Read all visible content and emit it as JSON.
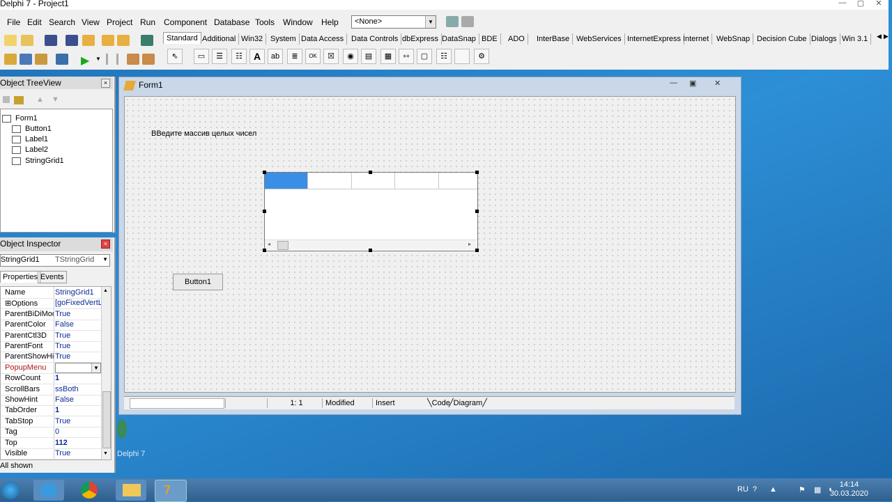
{
  "title_bar": {
    "title": "Delphi 7 - Project1"
  },
  "menu": [
    "File",
    "Edit",
    "Search",
    "View",
    "Project",
    "Run",
    "Component",
    "Database",
    "Tools",
    "Window",
    "Help"
  ],
  "config_combo": {
    "value": "<None>"
  },
  "palette_tabs": [
    "Standard",
    "Additional",
    "Win32",
    "System",
    "Data Access",
    "Data Controls",
    "dbExpress",
    "DataSnap",
    "BDE",
    "ADO",
    "InterBase",
    "WebServices",
    "InternetExpress",
    "Internet",
    "WebSnap",
    "Decision Cube",
    "Dialogs",
    "Win 3.1"
  ],
  "palette_active": "Standard",
  "tree_view": {
    "title": "Object TreeView",
    "root": "Form1",
    "children": [
      "Button1",
      "Label1",
      "Label2",
      "StringGrid1"
    ]
  },
  "inspector": {
    "title": "Object Inspector",
    "object_name": "StringGrid1",
    "object_type": "TStringGrid",
    "tabs": [
      "Properties",
      "Events"
    ],
    "properties": [
      {
        "name": "Name",
        "value": "StringGrid1",
        "bold": false
      },
      {
        "name": "⊞Options",
        "value": "[goFixedVertLi",
        "bold": false
      },
      {
        "name": "ParentBiDiMode",
        "value": "True",
        "bold": false
      },
      {
        "name": "ParentColor",
        "value": "False",
        "bold": false
      },
      {
        "name": "ParentCtl3D",
        "value": "True",
        "bold": false
      },
      {
        "name": "ParentFont",
        "value": "True",
        "bold": false
      },
      {
        "name": "ParentShowHint",
        "value": "True",
        "bold": false
      },
      {
        "name": "PopupMenu",
        "value": "",
        "bold": false,
        "selected": true
      },
      {
        "name": "RowCount",
        "value": "1",
        "bold": true
      },
      {
        "name": "ScrollBars",
        "value": "ssBoth",
        "bold": false
      },
      {
        "name": "ShowHint",
        "value": "False",
        "bold": false
      },
      {
        "name": "TabOrder",
        "value": "1",
        "bold": true
      },
      {
        "name": "TabStop",
        "value": "True",
        "bold": false
      },
      {
        "name": "Tag",
        "value": "0",
        "bold": false
      },
      {
        "name": "Top",
        "value": "112",
        "bold": true
      },
      {
        "name": "Visible",
        "value": "True",
        "bold": false
      }
    ],
    "status": "All shown"
  },
  "form": {
    "title": "Form1",
    "label_text": "ВВедите массив целых чисел",
    "button_caption": "Button1",
    "status": {
      "position": "1:   1",
      "modified": "Modified",
      "mode": "Insert",
      "tab_code": "Code",
      "tab_diagram": "Diagram"
    }
  },
  "taskbar": {
    "lang": "RU",
    "time": "14:14",
    "date": "30.03.2020",
    "desktop_label": "Delphi 7"
  },
  "colors": {
    "selected_cell": "#3a8ee6",
    "desktop": "#2d8fd6"
  }
}
